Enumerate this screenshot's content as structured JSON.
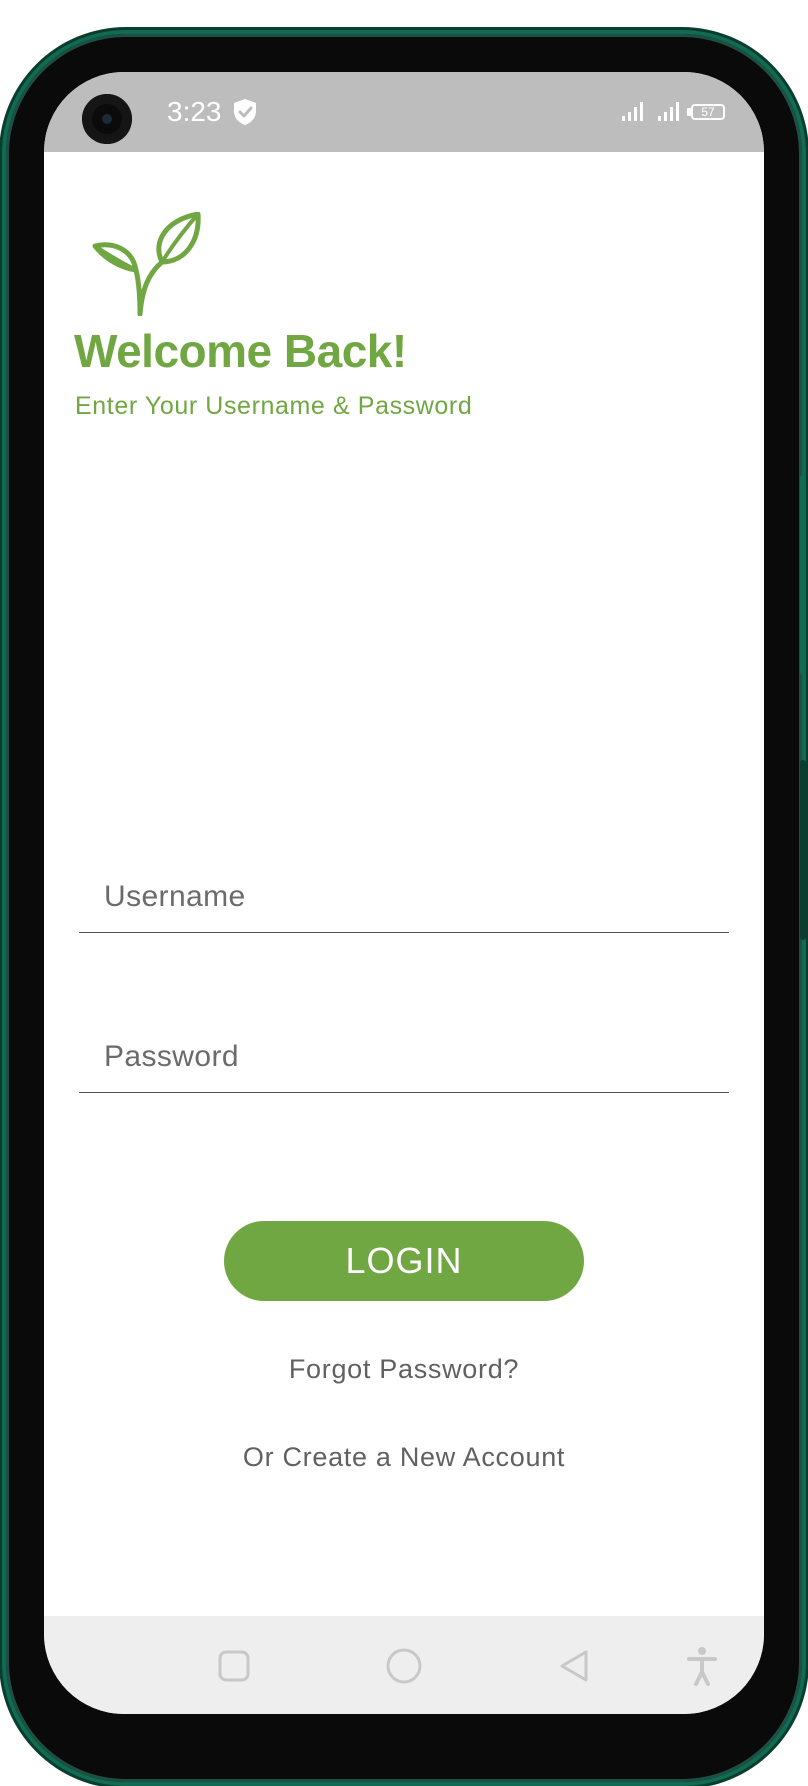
{
  "status_bar": {
    "time": "3:23",
    "battery_level": "57",
    "icons": [
      "shield-icon",
      "signal-icon",
      "signal-icon",
      "battery-icon"
    ]
  },
  "app": {
    "logo_icon": "leaf-sprout-icon",
    "welcome_title": "Welcome Back!",
    "welcome_subtitle": "Enter Your Username & Password",
    "accent_color": "#70a742"
  },
  "form": {
    "username": {
      "placeholder": "Username",
      "value": ""
    },
    "password": {
      "placeholder": "Password",
      "value": ""
    },
    "login_label": "LOGIN",
    "forgot_label": "Forgot Password?",
    "create_label": "Or Create a New Account"
  },
  "nav_bar": {
    "buttons": [
      "recents-icon",
      "home-icon",
      "back-icon",
      "accessibility-icon"
    ]
  }
}
